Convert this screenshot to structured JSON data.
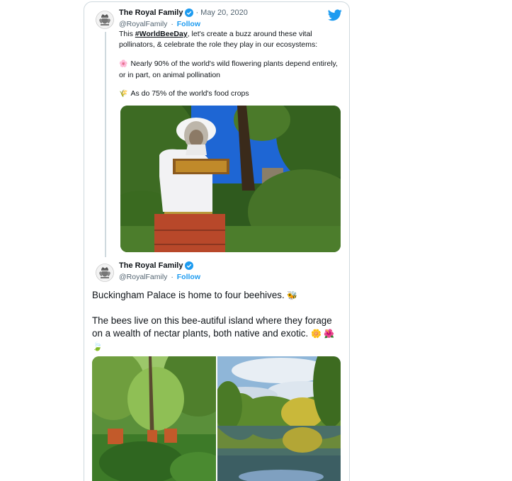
{
  "tweet1": {
    "author": "The Royal Family",
    "handle": "@RoyalFamily",
    "dot": "·",
    "date": "May 20, 2020",
    "follow": "Follow",
    "text_prefix": "This ",
    "hashtag": "#WorldBeeDay",
    "text_suffix": ", let's create a buzz around these vital pollinators, & celebrate the role they play in our ecosystems:",
    "bullet1_emoji": "🌸",
    "bullet1": "Nearly 90% of the world's wild flowering plants depend entirely, or in part, on animal pollination",
    "bullet2_emoji": "🌾",
    "bullet2": "As do 75% of the world's food crops",
    "icons": [
      "royal-crest-icon",
      "verified-badge-icon",
      "twitter-bird-icon"
    ]
  },
  "tweet2": {
    "author": "The Royal Family",
    "handle": "@RoyalFamily",
    "dot": "·",
    "follow": "Follow",
    "line1": "Buckingham Palace is home to four beehives.",
    "line1_emoji": "🐝",
    "line2": "The bees live on this bee-autiful island where they forage on a wealth of nectar plants, both native and exotic.",
    "line2_emoji": "🌼 🌺 🍃"
  },
  "colors": {
    "link_blue": "#1d9bf0",
    "text_dark": "#0f1419",
    "text_muted": "#536471",
    "border": "#cfd9de"
  }
}
